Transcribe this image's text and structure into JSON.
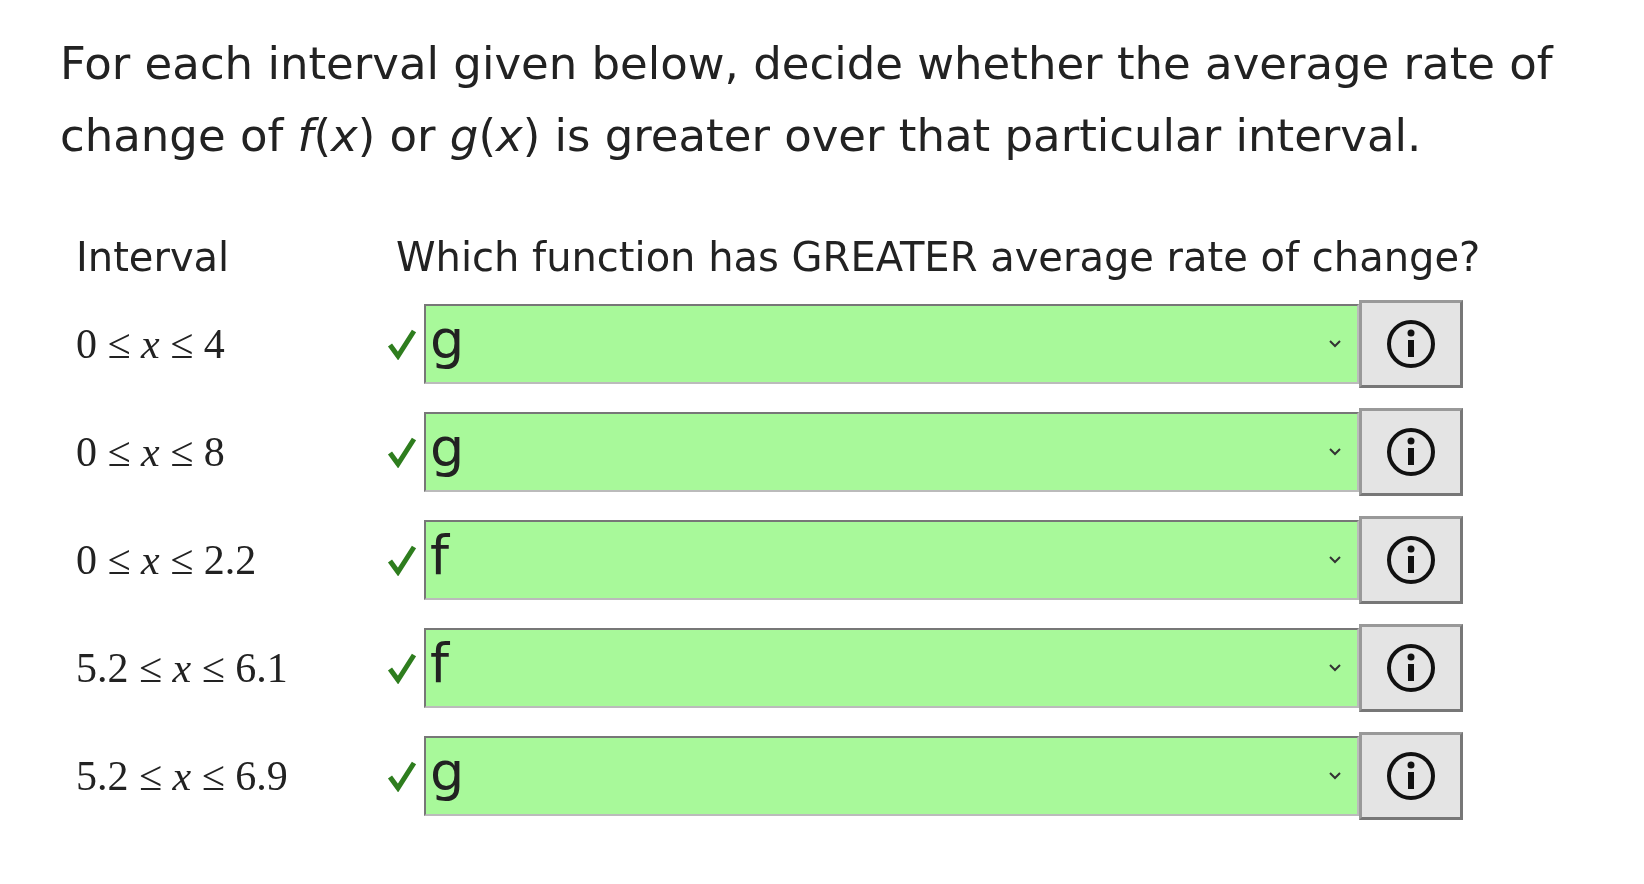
{
  "instructions": "For each interval given below, decide whether the average rate of change of *f*(*x*) or *g*(*x*) is greater over that particular interval.",
  "table": {
    "columns": [
      "Interval",
      "Which function has GREATER average rate of change?"
    ],
    "rows": [
      {
        "interval": "0 ≤ *x* ≤ 4",
        "answer": "g",
        "correct": true
      },
      {
        "interval": "0 ≤ *x* ≤ 8",
        "answer": "g",
        "correct": true
      },
      {
        "interval": "0 ≤ *x* ≤ 2.2",
        "answer": "f",
        "correct": true
      },
      {
        "interval": "5.2 ≤ *x* ≤ 6.1",
        "answer": "f",
        "correct": true
      },
      {
        "interval": "5.2 ≤ *x* ≤ 6.9",
        "answer": "g",
        "correct": true
      }
    ]
  }
}
